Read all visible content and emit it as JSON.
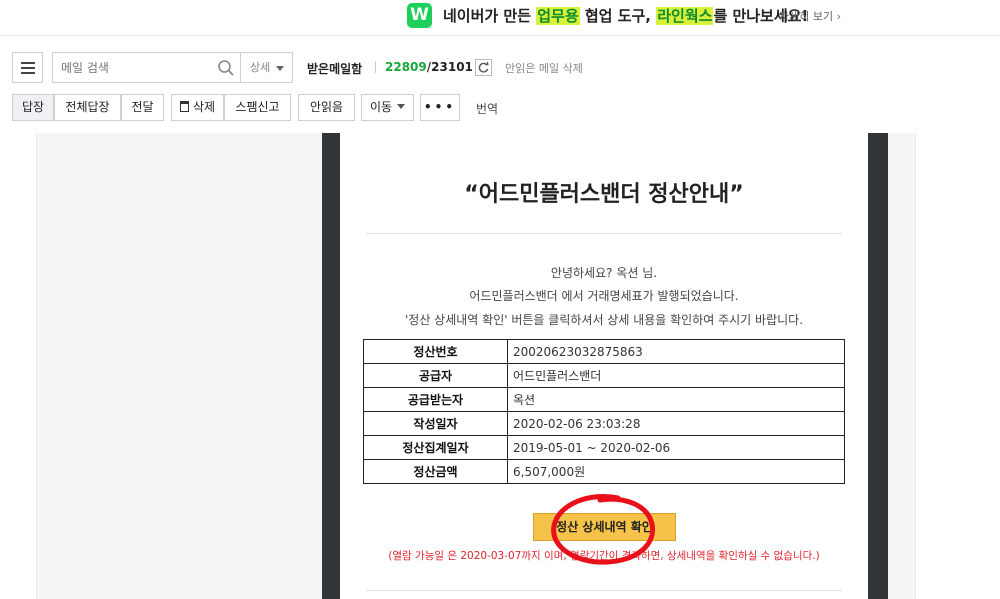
{
  "banner": {
    "logo_letter": "W",
    "text_1": "네이버가 만든 ",
    "highlight_1": "업무용",
    "text_2": " 협업 도구, ",
    "highlight_2": "라인웍스",
    "text_3": "를 만나보세요!",
    "more_label": "자세히 보기 ›"
  },
  "toolbar": {
    "search_placeholder": "메일 검색",
    "detail_label": "상세",
    "mailbox_label": "받은메일함",
    "unread_count": "22809",
    "slash": "/",
    "total_count": "23101",
    "delete_unread_label": "안읽은 메일 삭제",
    "buttons": {
      "reply": "답장",
      "reply_all": "전체답장",
      "forward": "전달",
      "delete": "삭제",
      "spam": "스팸신고",
      "unread": "안읽음",
      "move": "이동",
      "more": "•••"
    },
    "translate_label": "번역"
  },
  "mail": {
    "title": "“어드민플러스밴더 정산안내”",
    "greeting_1": "안녕하세요? 옥션 님.",
    "greeting_2": "어드민플러스밴더 에서 거래명세표가 발행되었습니다.",
    "greeting_3": "'정산 상세내역 확인' 버튼을 클릭하셔서 상세 내용을 확인하여 주시기 바랍니다.",
    "table": [
      {
        "label": "정산번호",
        "value": "20020623032875863"
      },
      {
        "label": "공급자",
        "value": "어드민플러스밴더"
      },
      {
        "label": "공급받는자",
        "value": "옥션"
      },
      {
        "label": "작성일자",
        "value": "2020-02-06 23:03:28"
      },
      {
        "label": "정산집계일자",
        "value": "2019-05-01 ~ 2020-02-06"
      },
      {
        "label": "정산금액",
        "value": "6,507,000원"
      }
    ],
    "confirm_button": "정산 상세내역 확인",
    "notice": "(열람 가능일 은 2020-03-07까지 이며, 열람기간이 경과하면, 상세내역을 확인하실 수 없습니다.)"
  },
  "colors": {
    "accent_green": "#18a83b",
    "button_yellow": "#f5c24a",
    "notice_red": "#e0242d",
    "annotation_red": "#e8101a",
    "frame_dark": "#323538"
  }
}
